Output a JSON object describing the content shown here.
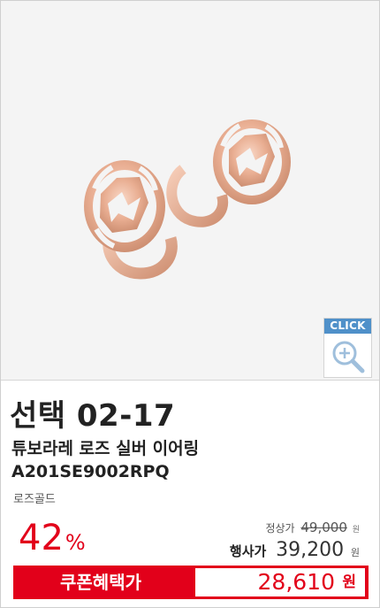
{
  "product": {
    "zoom_label": "CLICK",
    "promo_title": "선택 02-17",
    "name": "튜보라레 로즈 실버 이어링",
    "code": "A201SE9002RPQ",
    "color": "로즈골드"
  },
  "pricing": {
    "discount_number": "42",
    "discount_unit": "%",
    "regular_label": "정상가",
    "regular_value": "49,000",
    "sale_label": "행사가",
    "sale_value": "39,200",
    "coupon_label": "쿠폰혜택가",
    "coupon_value": "28,610",
    "currency": "원"
  },
  "colors": {
    "accent": "#e2001a",
    "zoom_badge": "#4f90c9",
    "rose_gold": "#e6a98d"
  }
}
